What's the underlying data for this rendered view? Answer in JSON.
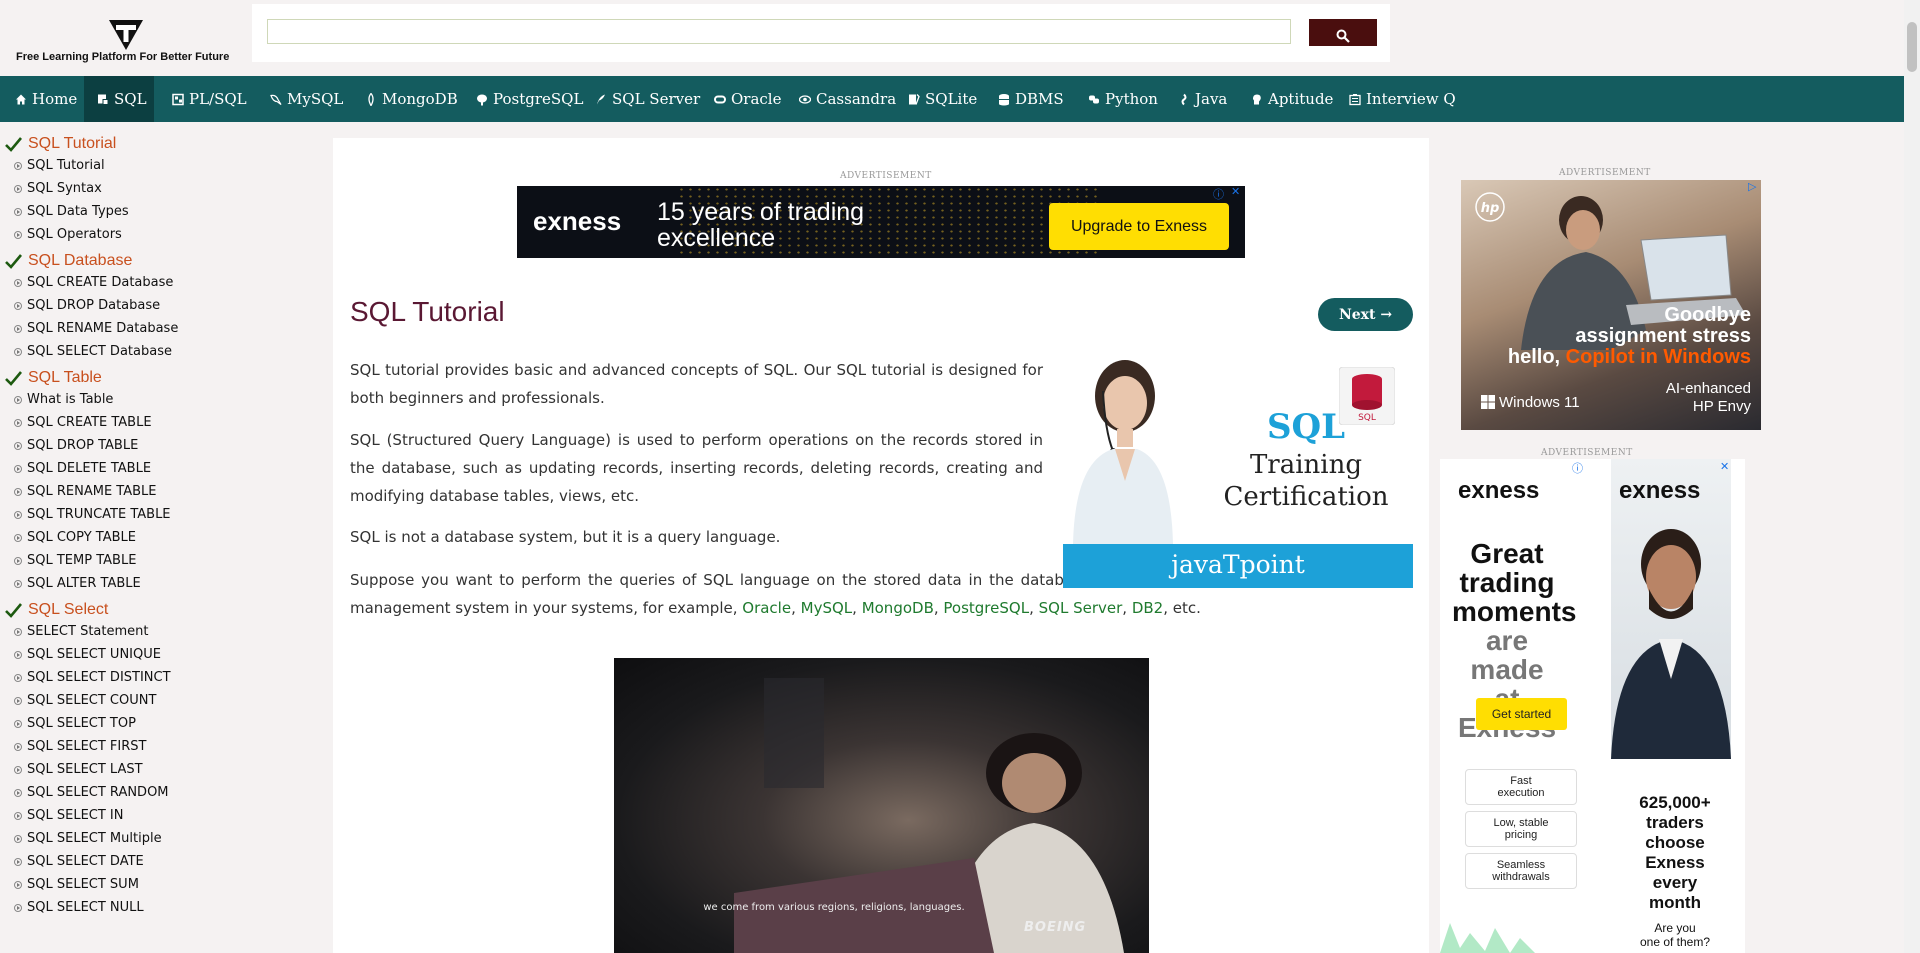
{
  "header": {
    "tagline": "Free Learning Platform For Better Future",
    "search": {
      "placeholder": "",
      "value": ""
    }
  },
  "nav": [
    {
      "label": "Home",
      "icon": "home-icon"
    },
    {
      "label": "SQL",
      "icon": "sql-icon",
      "active": true
    },
    {
      "label": "PL/SQL",
      "icon": "plsql-icon"
    },
    {
      "label": "MySQL",
      "icon": "mysql-icon"
    },
    {
      "label": "MongoDB",
      "icon": "mongodb-icon"
    },
    {
      "label": "PostgreSQL",
      "icon": "postgresql-icon"
    },
    {
      "label": "SQL Server",
      "icon": "sqlserver-icon"
    },
    {
      "label": "Oracle",
      "icon": "oracle-icon"
    },
    {
      "label": "Cassandra",
      "icon": "cassandra-icon"
    },
    {
      "label": "SQLite",
      "icon": "sqlite-icon"
    },
    {
      "label": "DBMS",
      "icon": "dbms-icon"
    },
    {
      "label": "Python",
      "icon": "python-icon"
    },
    {
      "label": "Java",
      "icon": "java-icon"
    },
    {
      "label": "Aptitude",
      "icon": "aptitude-icon"
    },
    {
      "label": "Interview Q",
      "icon": "interview-icon"
    }
  ],
  "sidebar": {
    "sections": [
      {
        "title": "SQL Tutorial",
        "items": [
          "SQL Tutorial",
          "SQL Syntax",
          "SQL Data Types",
          "SQL Operators"
        ]
      },
      {
        "title": "SQL Database",
        "items": [
          "SQL CREATE Database",
          "SQL DROP Database",
          "SQL RENAME Database",
          "SQL SELECT Database"
        ]
      },
      {
        "title": "SQL Table",
        "items": [
          "What is Table",
          "SQL CREATE TABLE",
          "SQL DROP TABLE",
          "SQL DELETE TABLE",
          "SQL RENAME TABLE",
          "SQL TRUNCATE TABLE",
          "SQL COPY TABLE",
          "SQL TEMP TABLE",
          "SQL ALTER TABLE"
        ]
      },
      {
        "title": "SQL Select",
        "items": [
          "SELECT Statement",
          "SQL SELECT UNIQUE",
          "SQL SELECT DISTINCT",
          "SQL SELECT COUNT",
          "SQL SELECT TOP",
          "SQL SELECT FIRST",
          "SQL SELECT LAST",
          "SQL SELECT RANDOM",
          "SQL SELECT IN",
          "SQL SELECT Multiple",
          "SQL SELECT DATE",
          "SQL SELECT SUM",
          "SQL SELECT NULL"
        ]
      }
    ]
  },
  "ads": {
    "label": "ADVERTISEMENT",
    "top_banner": {
      "brand": "exness",
      "line1": "15 years of trading",
      "line2": "excellence",
      "cta": "Upgrade to Exness"
    },
    "right1": {
      "line1": "Goodbye",
      "line2": "assignment stress",
      "line3a": "hello, ",
      "line3b": "Copilot in Windows",
      "foot_left": "Windows 11",
      "foot_right1": "AI-enhanced",
      "foot_right2": "HP Envy",
      "brand": "hp"
    },
    "right2": {
      "brand": "exness",
      "big1": "Great",
      "big2": "trading",
      "big3": "moments",
      "big4": "are made",
      "big5": "at Exness",
      "cta": "Get started",
      "pill1a": "Fast",
      "pill1b": "execution",
      "pill2a": "Low, stable",
      "pill2b": "pricing",
      "pill3a": "Seamless",
      "pill3b": "withdrawals",
      "stat1": "625,000+",
      "stat2": "traders",
      "stat3": "choose",
      "stat4": "Exness",
      "stat5": "every",
      "stat6": "month",
      "q1": "Are you",
      "q2": "one of them?"
    }
  },
  "main": {
    "title": "SQL Tutorial",
    "next_label": "Next →",
    "p1": "SQL tutorial provides basic and advanced concepts of SQL. Our SQL tutorial is designed for both beginners and professionals.",
    "p2": "SQL (Structured Query Language) is used to perform operations on the records stored in the database, such as updating records, inserting records, deleting records, creating and modifying database tables, views, etc.",
    "p3": "SQL is not a database system, but it is a query language.",
    "p4_text": "Suppose you want to perform the queries of SQL language on the stored data in the database. You are required to install any database management system in your systems, for example, ",
    "p4_links": [
      "Oracle",
      "MySQL",
      "MongoDB",
      "PostgreSQL",
      "SQL Server",
      "DB2"
    ],
    "p4_sep": ", ",
    "p4_end": ", etc.",
    "promo": {
      "sql": "SQL",
      "line1": "Training",
      "line2": "Certification",
      "brand": "javaTpoint",
      "badge": "SQL"
    },
    "video": {
      "caption": "we come from various regions, religions, languages.",
      "brand": "BOEING"
    }
  },
  "colors": {
    "nav_bg": "#145c5f",
    "nav_active": "#0c3f41",
    "section_title": "#c8501e",
    "page_title": "#5a1833",
    "link": "#1f7a2e",
    "search_button": "#4a0e0e",
    "exness_yellow": "#ffde02",
    "promo_blue": "#1da1d8"
  }
}
